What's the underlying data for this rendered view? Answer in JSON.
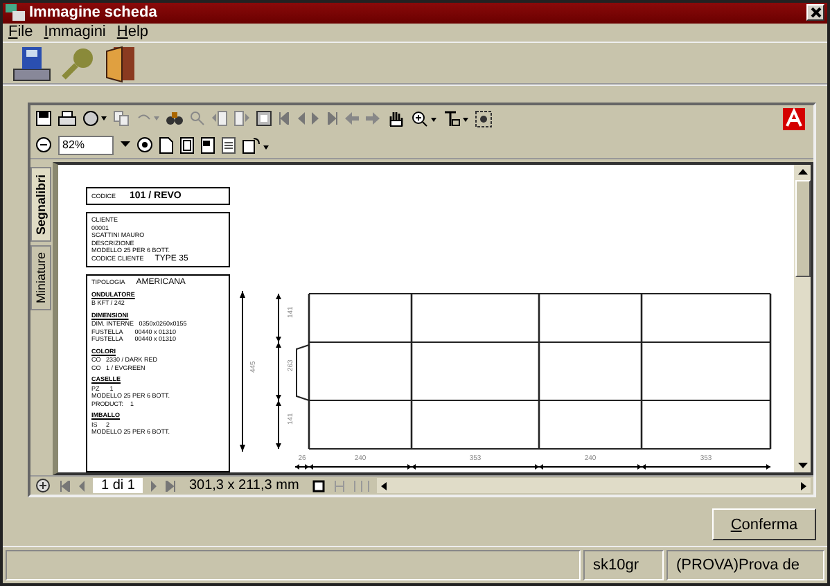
{
  "window": {
    "title": "Immagine scheda"
  },
  "menu": [
    {
      "label": "File"
    },
    {
      "label": "Immagini"
    },
    {
      "label": "Help"
    }
  ],
  "viewer": {
    "zoom": "82%",
    "side_tabs": [
      {
        "label": "Segnalibri",
        "selected": true
      },
      {
        "label": "Miniature",
        "selected": false
      }
    ],
    "document": {
      "code_label": "CODICE",
      "code": "101   / REVO",
      "client_lines": [
        "CLIENTE",
        "00001",
        "SCATTINI MAURO",
        "DESCRIZIONE",
        "MODELLO 25 PER 6 BOTT."
      ],
      "type_label": "CODICE CLIENTE",
      "type": "TYPE 35",
      "spec_label": "TIPOLOGIA",
      "spec": "AMERICANA",
      "sections": [
        {
          "heading": "ONDULATORE",
          "lines": [
            "B KFT / 242"
          ]
        },
        {
          "heading": "DIMENSIONI",
          "lines": [
            "DIM. INTERNE   0350x0260x0155",
            "FUSTELLA       00440 x 01310",
            "FUSTELLA       00440 x 01310"
          ]
        },
        {
          "heading": "COLORI",
          "lines": [
            "CO   2330 / DARK RED",
            "CO   1 / EVGREEN"
          ]
        },
        {
          "heading": "CASELLE",
          "lines": [
            "PZ      1",
            "MODELLO 25 PER 6 BOTT.",
            "PRODUCT:    1"
          ]
        },
        {
          "heading": "IMBALLO",
          "lines": [
            "IS     2",
            "MODELLO 25 PER 6 BOTT."
          ]
        }
      ],
      "vertical_labels": [
        "445",
        "141",
        "263",
        "141"
      ],
      "horizontal_labels": [
        "26",
        "240",
        "353",
        "240",
        "353"
      ]
    },
    "page": "1 di 1",
    "page_size": "301,3 x 211,3 mm"
  },
  "confirm_button": "Conferma",
  "status_bar": [
    "sk10gr",
    "(PROVA)Prova de"
  ]
}
